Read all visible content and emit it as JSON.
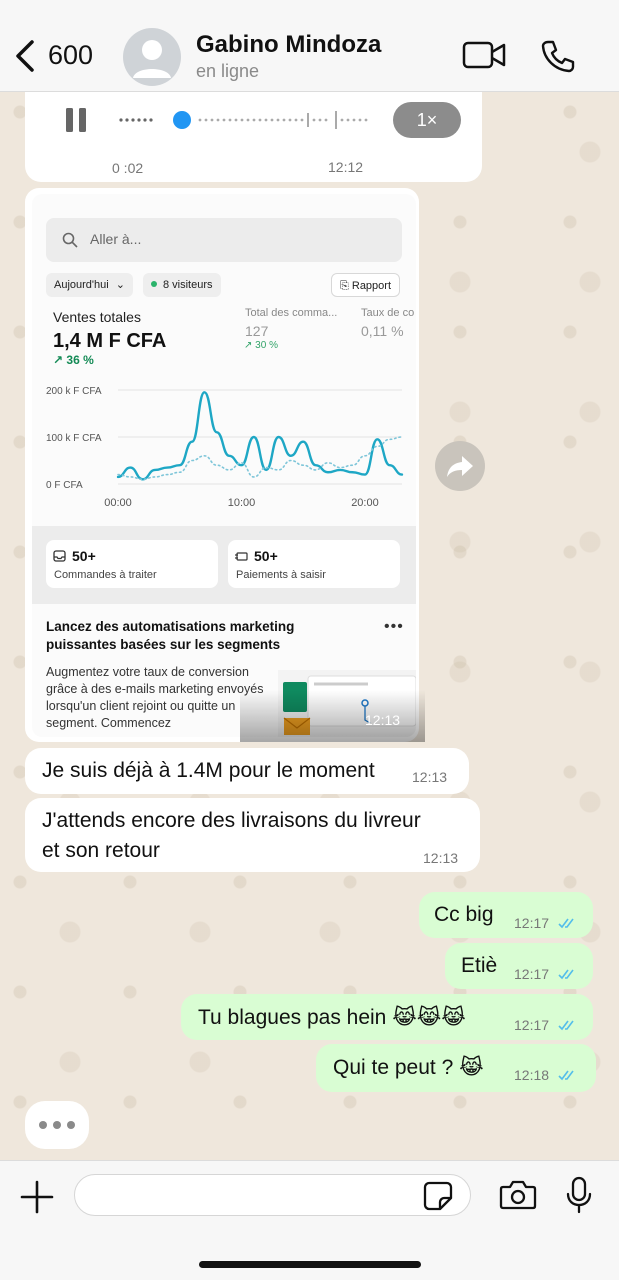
{
  "header": {
    "back_count": "600",
    "contact_name": "Gabino Mindoza",
    "status": "en ligne"
  },
  "voice_message": {
    "speed": "1×",
    "duration": "0 :02",
    "time": "12:12"
  },
  "image_message": {
    "time": "12:13",
    "search_placeholder": "Aller à...",
    "filter_today": "Aujourd'hui",
    "visitors": "8 visiteurs",
    "report": "Rapport",
    "total_sales_label": "Ventes totales",
    "total_sales_value": "1,4 M F CFA",
    "total_sales_trend": "36 %",
    "orders_total_label": "Total des comma...",
    "orders_total_value": "127",
    "orders_total_trend": "30 %",
    "conversion_label": "Taux de co",
    "conversion_value": "0,11 %",
    "stat_orders_value": "50+",
    "stat_orders_label": "Commandes à traiter",
    "stat_payments_value": "50+",
    "stat_payments_label": "Paiements à saisir",
    "promo_title": "Lancez des automatisations marketing puissantes basées sur les segments",
    "promo_body": "Augmentez votre taux de conversion grâce à des e-mails marketing envoyés lorsqu'un client rejoint ou quitte un segment. Commencez",
    "promo_menu": "•••"
  },
  "chart_data": {
    "type": "line",
    "title": "",
    "y_tick_labels": [
      "200 k F CFA",
      "100 k F CFA",
      "0 F CFA"
    ],
    "x_tick_labels": [
      "00:00",
      "10:00",
      "20:00"
    ],
    "ylim": [
      0,
      200
    ],
    "y_unit": "k F CFA",
    "grid": true,
    "x": [
      0,
      1,
      2,
      3,
      4,
      5,
      6,
      7,
      8,
      9,
      10,
      11,
      12,
      13,
      14,
      15,
      16,
      17,
      18,
      19,
      20,
      21,
      22,
      23
    ],
    "series": [
      {
        "values": [
          15,
          35,
          10,
          30,
          35,
          40,
          90,
          195,
          110,
          60,
          40,
          100,
          30,
          100,
          60,
          90,
          40,
          25,
          30,
          25,
          20,
          95,
          40,
          20
        ],
        "style": "solid",
        "color": "#1ea7c5"
      },
      {
        "values": [
          20,
          15,
          10,
          15,
          20,
          25,
          50,
          60,
          40,
          30,
          45,
          15,
          35,
          30,
          50,
          40,
          30,
          45,
          35,
          40,
          60,
          80,
          95,
          100
        ],
        "style": "dotted",
        "color": "#7fc6d9"
      }
    ]
  },
  "messages": [
    {
      "dir": "in",
      "text": "Je suis déjà à 1.4M pour le moment",
      "time": "12:13"
    },
    {
      "dir": "in",
      "text_line1": "J'attends encore des livraisons du livreur",
      "text_line2": "et son retour",
      "time": "12:13"
    },
    {
      "dir": "out",
      "text": "Cc big",
      "time": "12:17"
    },
    {
      "dir": "out",
      "text": "Etiè",
      "time": "12:17"
    },
    {
      "dir": "out",
      "text": "Tu blagues pas hein 😹😹😹",
      "time": "12:17"
    },
    {
      "dir": "out",
      "text": "Qui te peut ? 😹",
      "time": "12:18"
    }
  ],
  "composer": {
    "value": "",
    "placeholder": ""
  },
  "colors": {
    "outgoing_bubble": "#d9fdd3",
    "incoming_bubble": "#ffffff",
    "read_ticks": "#53bdeb",
    "chart_line": "#1ea7c5"
  },
  "icons": [
    "back-arrow-icon",
    "avatar-placeholder-icon",
    "video-call-icon",
    "phone-call-icon",
    "pause-icon",
    "forward-icon",
    "plus-icon",
    "sticker-icon",
    "camera-icon",
    "microphone-icon",
    "search-icon",
    "read-receipt-icon"
  ]
}
